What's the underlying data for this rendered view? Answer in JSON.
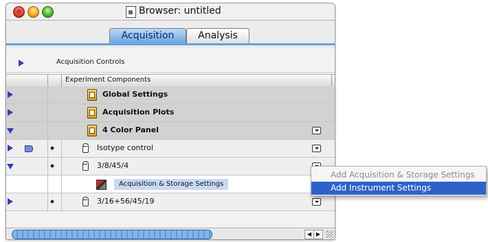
{
  "window": {
    "title": "Browser: untitled"
  },
  "tabs": [
    {
      "label": "Acquisition",
      "selected": true
    },
    {
      "label": "Analysis",
      "selected": false
    }
  ],
  "acquisition_controls": {
    "label": "Acquisition Controls"
  },
  "table": {
    "column_header": "Experiment Components",
    "rows": [
      {
        "label": "Global Settings",
        "bold": true,
        "expanded": false
      },
      {
        "label": "Acquisition Plots",
        "bold": true,
        "expanded": false
      },
      {
        "label": "4 Color Panel",
        "bold": true,
        "expanded": true
      },
      {
        "label": "Isotype control",
        "bold": false,
        "expanded": false
      },
      {
        "label": "3/8/45/4",
        "bold": false,
        "expanded": true
      },
      {
        "label": "Acquisition & Storage Settings",
        "bold": false,
        "selected": true
      },
      {
        "label": "3/16+56/45/19",
        "bold": false,
        "expanded": false
      }
    ]
  },
  "context_menu": {
    "items": [
      {
        "label": "Add Acquisition & Storage Settings",
        "enabled": false
      },
      {
        "label": "Add Instrument Settings",
        "enabled": true,
        "highlighted": true
      }
    ]
  },
  "colors": {
    "accent_blue": "#2f62c8",
    "tab_selected": "#6aa5e3",
    "disclosure_triangle": "#2f3fb5"
  }
}
